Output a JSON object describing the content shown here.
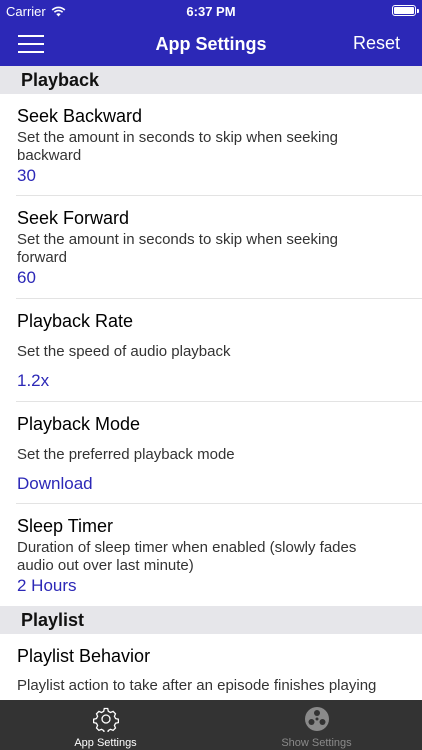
{
  "status_bar": {
    "carrier": "Carrier",
    "time": "6:37 PM"
  },
  "nav": {
    "title": "App Settings",
    "reset_label": "Reset"
  },
  "sections": [
    {
      "title": "Playback",
      "items": [
        {
          "label": "Seek Backward",
          "description": "Set the amount in seconds to skip when seeking backward",
          "value": "30"
        },
        {
          "label": "Seek Forward",
          "description": "Set the amount in seconds to skip when seeking forward",
          "value": "60"
        },
        {
          "label": "Playback Rate",
          "description": "Set the speed of audio playback",
          "value": "1.2x"
        },
        {
          "label": "Playback Mode",
          "description": "Set the preferred playback mode",
          "value": "Download"
        },
        {
          "label": "Sleep Timer",
          "description": "Duration of sleep timer when enabled (slowly fades audio out over last minute)",
          "value": "2 Hours"
        }
      ]
    },
    {
      "title": "Playlist",
      "items": [
        {
          "label": "Playlist Behavior",
          "description": "Playlist action to take after an episode finishes playing",
          "value": ""
        }
      ]
    }
  ],
  "tabs": [
    {
      "label": "App Settings",
      "icon": "gear-icon",
      "active": true
    },
    {
      "label": "Show Settings",
      "icon": "film-reel-icon",
      "active": false
    }
  ],
  "colors": {
    "accent": "#2c28b7",
    "section_bg": "#e6e6ea",
    "tabbar_bg": "#333333"
  }
}
